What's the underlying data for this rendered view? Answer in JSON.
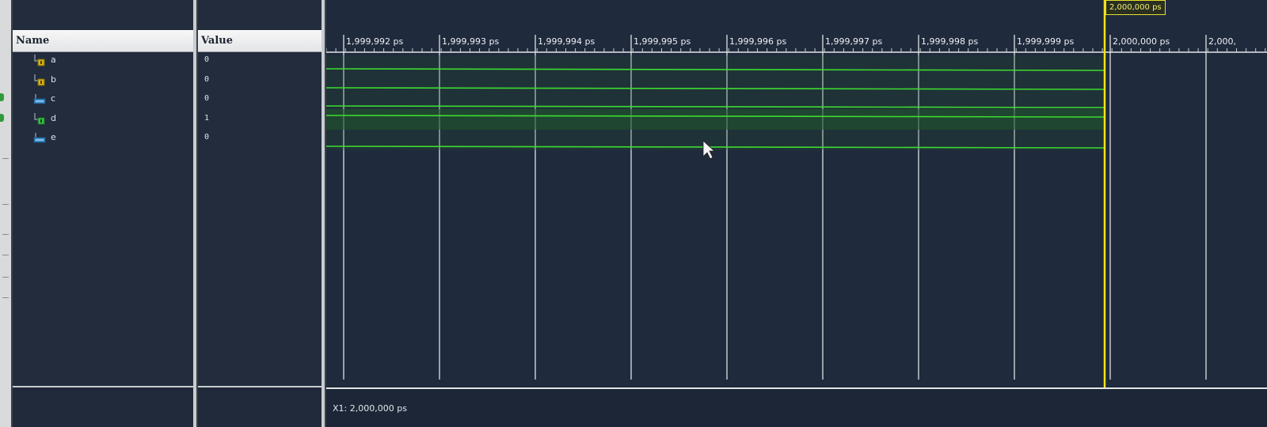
{
  "columns": {
    "name_header": "Name",
    "value_header": "Value"
  },
  "signals": [
    {
      "name": "a",
      "value": "0",
      "icon": "input-port-icon"
    },
    {
      "name": "b",
      "value": "0",
      "icon": "input-port-icon"
    },
    {
      "name": "c",
      "value": "0",
      "icon": "output-port-icon"
    },
    {
      "name": "d",
      "value": "1",
      "icon": "inout-port-icon"
    },
    {
      "name": "e",
      "value": "0",
      "icon": "output-port-icon"
    }
  ],
  "timeline": {
    "ticks": [
      "1,999,992 ps",
      "1,999,993 ps",
      "1,999,994 ps",
      "1,999,995 ps",
      "1,999,996 ps",
      "1,999,997 ps",
      "1,999,998 ps",
      "1,999,999 ps",
      "2,000,000 ps",
      "2,000,"
    ],
    "cursor_label": "2,000,000 ps",
    "cursor_tick_index": 8
  },
  "status": {
    "cursor_readout": "X1: 2,000,000 ps"
  },
  "colors": {
    "waveform": "#3ddc2f",
    "cursor": "#f2e21a",
    "background": "#1f2a3c"
  }
}
